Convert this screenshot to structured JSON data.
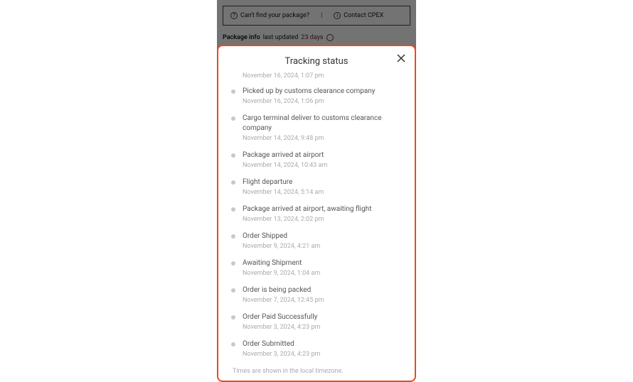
{
  "background": {
    "help_box": {
      "find_package": "Can't find your package?",
      "contact": "Contact CPEX"
    },
    "package_info": {
      "label": "Package info",
      "text": "last updated",
      "time": "23 days"
    }
  },
  "modal": {
    "title": "Tracking status",
    "timezone_note": "Times are shown in the local timezone.",
    "events": [
      {
        "status": "",
        "date": "November 16, 2024, 1:07 pm",
        "truncated": true
      },
      {
        "status": "Picked up by customs clearance company",
        "date": "November 16, 2024, 1:06 pm"
      },
      {
        "status": "Cargo terminal deliver to customs clearance company",
        "date": "November 14, 2024, 9:48 pm"
      },
      {
        "status": "Package arrived at airport",
        "date": "November 14, 2024, 10:43 am"
      },
      {
        "status": "Flight departure",
        "date": "November 14, 2024, 5:14 am"
      },
      {
        "status": "Package arrived at airport, awaiting flight",
        "date": "November 13, 2024, 2:02 pm"
      },
      {
        "status": "Order Shipped",
        "date": "November 9, 2024, 4:21 am"
      },
      {
        "status": "Awaiting Shipment",
        "date": "November 9, 2024, 1:04 am"
      },
      {
        "status": "Order is being packed",
        "date": "November 7, 2024, 12:45 pm"
      },
      {
        "status": "Order Paid Successfully",
        "date": "November 3, 2024, 4:23 pm"
      },
      {
        "status": "Order Submitted",
        "date": "November 3, 2024, 4:23 pm"
      }
    ]
  }
}
